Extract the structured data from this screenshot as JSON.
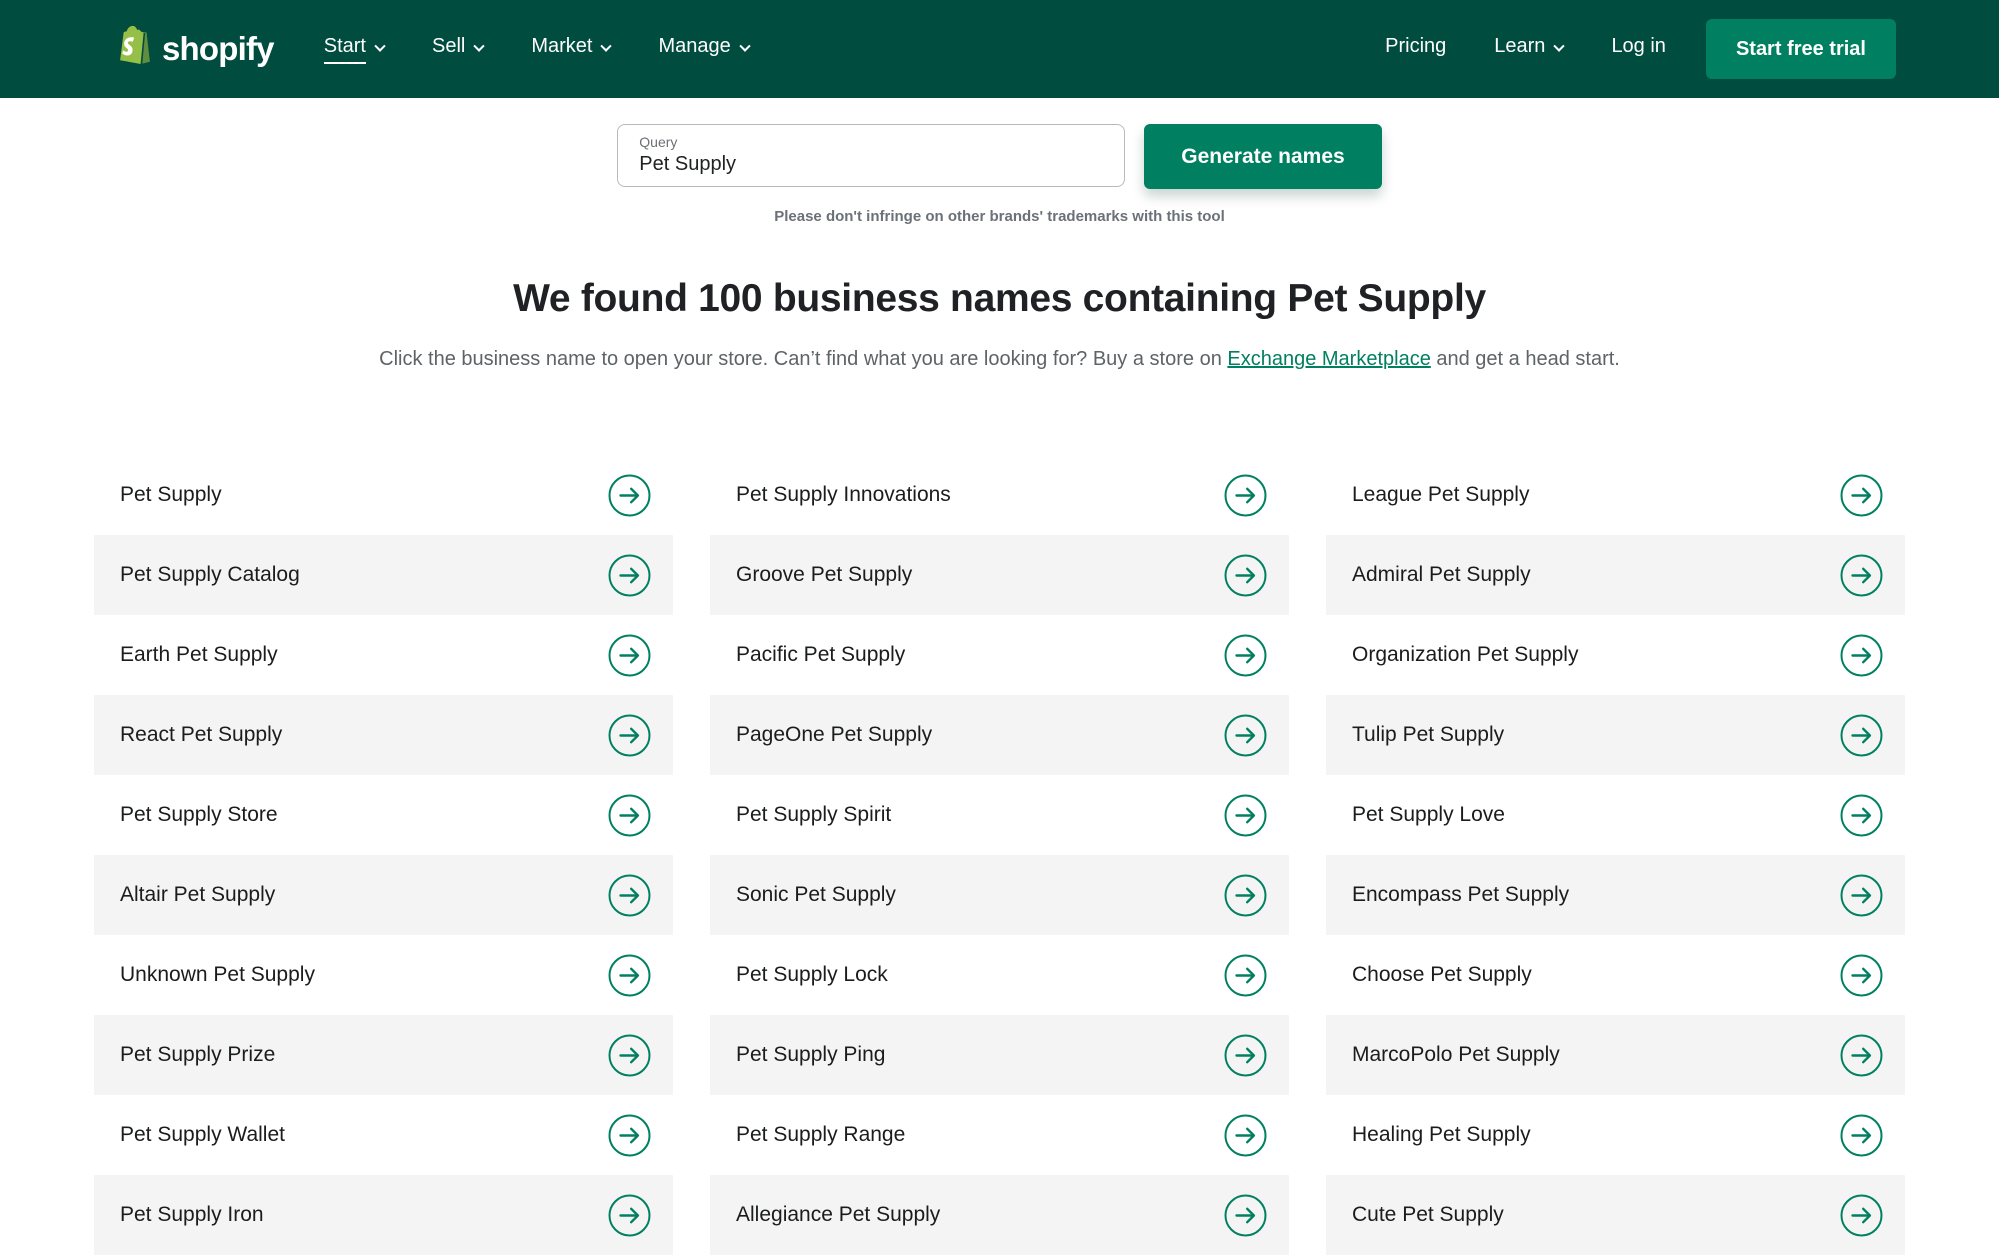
{
  "header": {
    "brand": "shopify",
    "nav": [
      {
        "label": "Start",
        "has_chevron": true,
        "active": true
      },
      {
        "label": "Sell",
        "has_chevron": true
      },
      {
        "label": "Market",
        "has_chevron": true
      },
      {
        "label": "Manage",
        "has_chevron": true
      }
    ],
    "nav_right": [
      {
        "label": "Pricing",
        "has_chevron": false
      },
      {
        "label": "Learn",
        "has_chevron": true
      },
      {
        "label": "Log in",
        "has_chevron": false
      }
    ],
    "cta_label": "Start free trial"
  },
  "search": {
    "label": "Query",
    "value": "Pet Supply",
    "button_label": "Generate names",
    "disclaimer": "Please don't infringe on other brands' trademarks with this tool"
  },
  "results": {
    "title": "We found 100 business names containing Pet Supply",
    "subtitle_before": "Click the business name to open your store. Can’t find what you are looking for? Buy a store on ",
    "subtitle_link": "Exchange Marketplace",
    "subtitle_after": " and get a head start.",
    "columns": [
      [
        "Pet Supply",
        "Pet Supply Catalog",
        "Earth Pet Supply",
        "React Pet Supply",
        "Pet Supply Store",
        "Altair Pet Supply",
        "Unknown Pet Supply",
        "Pet Supply Prize",
        "Pet Supply Wallet",
        "Pet Supply Iron"
      ],
      [
        "Pet Supply Innovations",
        "Groove Pet Supply",
        "Pacific Pet Supply",
        "PageOne Pet Supply",
        "Pet Supply Spirit",
        "Sonic Pet Supply",
        "Pet Supply Lock",
        "Pet Supply Ping",
        "Pet Supply Range",
        "Allegiance Pet Supply"
      ],
      [
        "League Pet Supply",
        "Admiral Pet Supply",
        "Organization Pet Supply",
        "Tulip Pet Supply",
        "Pet Supply Love",
        "Encompass Pet Supply",
        "Choose Pet Supply",
        "MarcoPolo Pet Supply",
        "Healing Pet Supply",
        "Cute Pet Supply"
      ]
    ]
  },
  "icons": {
    "logo": "shopify-bag-icon",
    "nav_caret": "chevron-down-icon",
    "row_action": "arrow-right-icon"
  },
  "colors": {
    "header_bg": "#004c3f",
    "accent": "#008060",
    "row_alt": "#f4f4f4",
    "logo_green": "#95bf47",
    "logo_shade": "#5e8e3e",
    "muted_text": "#6b7177"
  }
}
